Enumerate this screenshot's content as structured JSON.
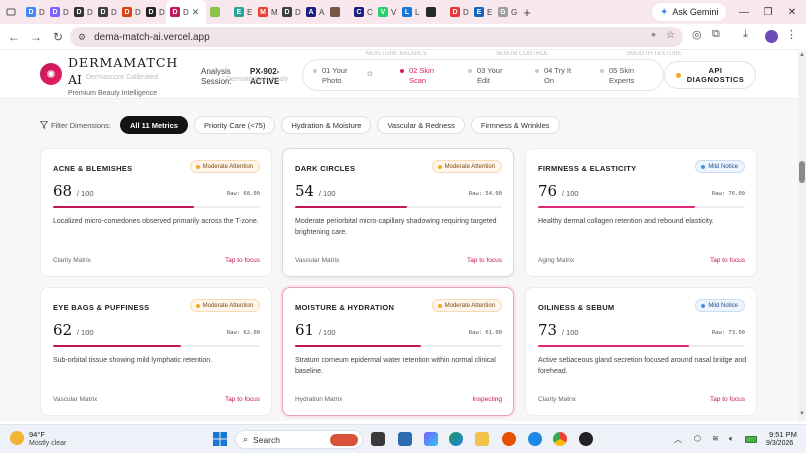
{
  "browser": {
    "tabs": [
      {
        "label": "D",
        "color": "#4285f4",
        "glyph": "D"
      },
      {
        "label": "D",
        "color": "#7b61ff",
        "glyph": "D"
      },
      {
        "label": "D",
        "color": "#333333",
        "glyph": "D"
      },
      {
        "label": "D",
        "color": "#3c4043",
        "glyph": "D"
      },
      {
        "label": "D",
        "color": "#d84315",
        "glyph": "D"
      },
      {
        "label": "D",
        "color": "#222222",
        "glyph": "D"
      },
      {
        "label": "D",
        "active": true,
        "color": "#c2185b",
        "glyph": "D"
      },
      {
        "label": "",
        "color": "#8bc34a",
        "glyph": ""
      },
      {
        "label": "E",
        "color": "#26a69a",
        "glyph": "E"
      },
      {
        "label": "M",
        "color": "#ea4335",
        "glyph": "M"
      },
      {
        "label": "D",
        "color": "#3c4043",
        "glyph": "D"
      },
      {
        "label": "A",
        "color": "#1a237e",
        "glyph": "A"
      },
      {
        "label": "",
        "color": "#795548",
        "glyph": ""
      },
      {
        "label": "C",
        "color": "#1a237e",
        "glyph": "C"
      },
      {
        "label": "V",
        "color": "#25d366",
        "glyph": "V"
      },
      {
        "label": "L",
        "color": "#1976d2",
        "glyph": "L"
      },
      {
        "label": "",
        "color": "#24292e",
        "glyph": ""
      },
      {
        "label": "D",
        "color": "#e53935",
        "glyph": "D"
      },
      {
        "label": "E",
        "color": "#1565c0",
        "glyph": "E"
      },
      {
        "label": "G",
        "color": "#9e9e9e",
        "glyph": "G"
      }
    ],
    "gemini_label": "Ask Gemini",
    "url": "dema-match-ai.vercel.app"
  },
  "app": {
    "brand_line1": "DERMAMATCH",
    "brand_line2": "AI",
    "brand_ghost": "Dermascore Calibrated",
    "tagline": "Premium Beauty Intelligence",
    "session_label_1": "Analysis",
    "session_label_2": "Session:",
    "session_id_1": "PX-902-",
    "session_id_2": "ACTIVE",
    "session_ghost": "Dermatoscale Analy",
    "ghost_labels": [
      "MOISTURE BALANCE",
      "SEBUM CONTROL",
      "SMOOTH TEXTURE"
    ],
    "steps": [
      {
        "num": "01",
        "label1": "01 Your",
        "label2": "Photo",
        "active": false
      },
      {
        "num": "02",
        "label1": "02 Skin",
        "label2": "Scan",
        "active": true
      },
      {
        "num": "03",
        "label1": "03 Your",
        "label2": "Edit",
        "active": false
      },
      {
        "num": "04",
        "label1": "04 Try It",
        "label2": "On",
        "active": false
      },
      {
        "num": "05",
        "label1": "05 Skin",
        "label2": "Experts",
        "active": false
      }
    ],
    "api_label_1": "API",
    "api_label_2": "DIAGNOSTICS",
    "filter_label": "Filter Dimensions:",
    "filters": [
      "All 11 Metrics",
      "Priority Care (<75)",
      "Hydration & Moisture",
      "Vascular & Redness",
      "Firmness & Wrinkles"
    ],
    "active_filter": 0,
    "score_max": "/ 100",
    "cards": [
      {
        "title": "ACNE & BLEMISHES",
        "badge": "Moderate Attention",
        "level": "moderate",
        "score": "68",
        "raw": "Raw: 68.00",
        "progress": 0.68,
        "desc": "Localized micro-comedones observed primarily across the T-zone.",
        "matrix": "Clarity Matrix",
        "action": "Tap to focus",
        "state": "normal"
      },
      {
        "title": "DARK CIRCLES",
        "badge": "Moderate Attention",
        "level": "moderate",
        "score": "54",
        "raw": "Raw: 54.00",
        "progress": 0.54,
        "desc": "Moderate periorbital micro-capillary shadowing requiring targeted brightening care.",
        "matrix": "Vascular Matrix",
        "action": "Tap to focus",
        "state": "hover"
      },
      {
        "title": "FIRMNESS & ELASTICITY",
        "badge": "Mild Notice",
        "level": "mild",
        "score": "76",
        "raw": "Raw: 76.00",
        "progress": 0.76,
        "desc": "Healthy dermal collagen retention and rebound elasticity.",
        "matrix": "Aging Matrix",
        "action": "Tap to focus",
        "state": "normal"
      },
      {
        "title": "EYE BAGS & PUFFINESS",
        "badge": "Moderate Attention",
        "level": "moderate",
        "score": "62",
        "raw": "Raw: 62.00",
        "progress": 0.62,
        "desc": "Sub-orbital tissue showing mild lymphatic retention.",
        "matrix": "Vascular Matrix",
        "action": "Tap to focus",
        "state": "normal"
      },
      {
        "title": "MOISTURE & HYDRATION",
        "badge": "Moderate Attention",
        "level": "moderate",
        "score": "61",
        "raw": "Raw: 61.00",
        "progress": 0.61,
        "desc": "Stratum corneum epidermal water retention within normal clinical baseline.",
        "matrix": "Hydration Matrix",
        "action": "Inspecting",
        "state": "inspect"
      },
      {
        "title": "OILINESS & SEBUM",
        "badge": "Mild Notice",
        "level": "mild",
        "score": "73",
        "raw": "Raw: 73.00",
        "progress": 0.73,
        "desc": "Active sebaceous gland secretion focused around nasal bridge and forehead.",
        "matrix": "Clarity Matrix",
        "action": "Tap to focus",
        "state": "normal"
      }
    ],
    "colors": {
      "accent": "#c2185b",
      "moderate": "#f5a623",
      "mild": "#4a90e2"
    }
  },
  "taskbar": {
    "temp": "94°F",
    "weather": "Mostly clear",
    "search_label": "Search",
    "time": "9:51 PM",
    "date": "9/3/2026"
  }
}
